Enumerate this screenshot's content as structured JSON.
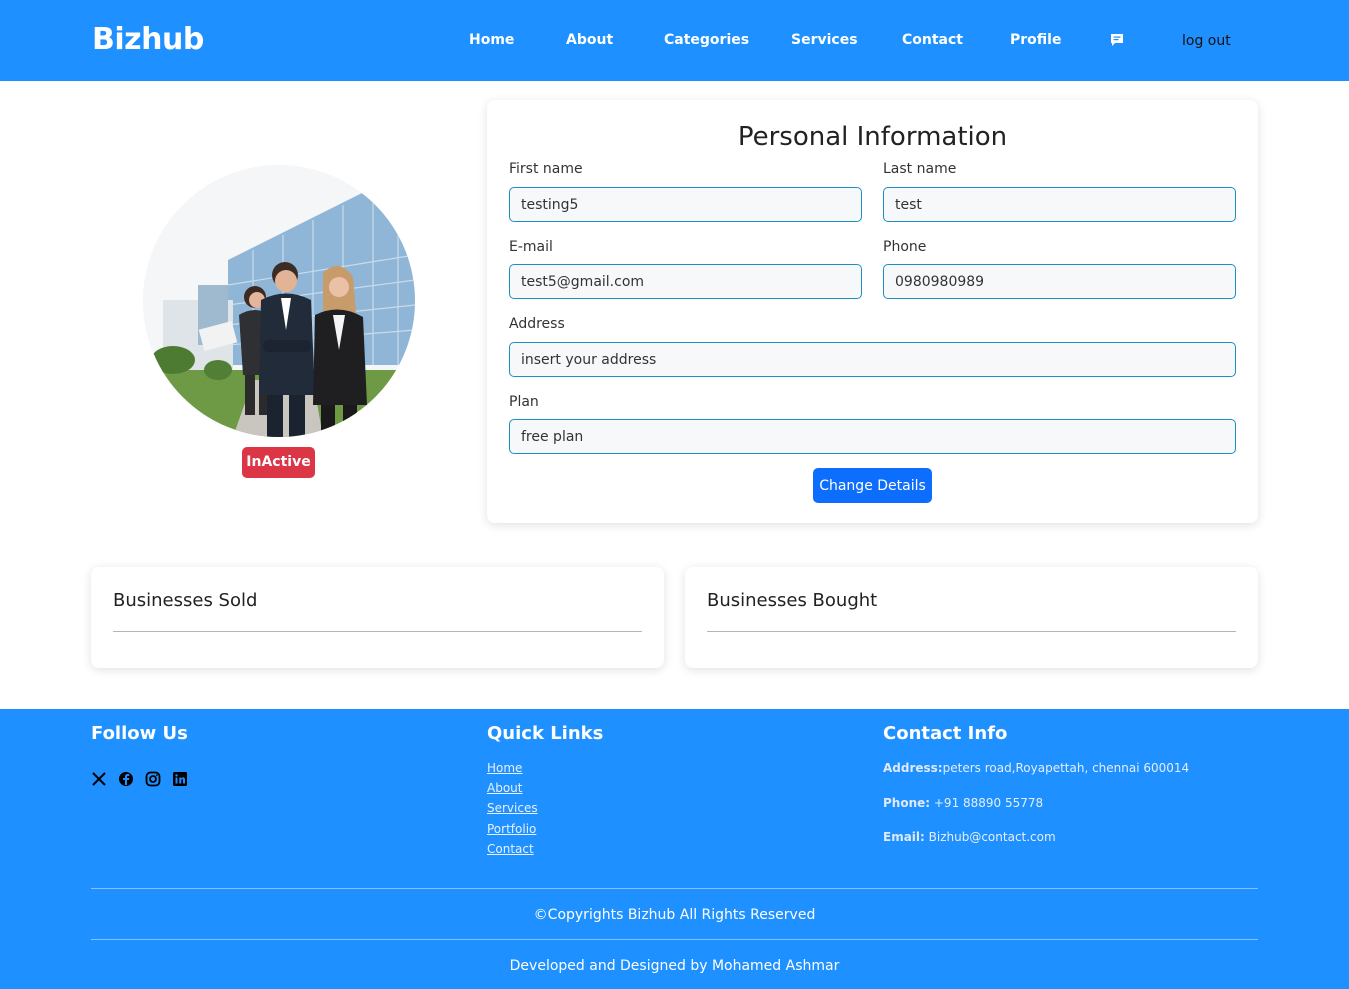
{
  "header": {
    "brand": "Bizhub",
    "nav": [
      "Home",
      "About",
      "Categories",
      "Services",
      "Contact",
      "Profile"
    ],
    "chat_icon": "chat-icon",
    "logout": "log out"
  },
  "profile": {
    "status": "InActive",
    "status_color": "#dc3545"
  },
  "form": {
    "title": "Personal Information",
    "first_name_label": "First name",
    "first_name": "testing5",
    "last_name_label": "Last name",
    "last_name": "test",
    "email_label": "E-mail",
    "email": "test5@gmail.com",
    "phone_label": "Phone",
    "phone": "0980980989",
    "address_label": "Address",
    "address": "insert your address",
    "plan_label": "Plan",
    "plan": "free plan",
    "submit": "Change Details"
  },
  "businesses": {
    "sold_title": "Businesses Sold",
    "bought_title": "Businesses Bought"
  },
  "footer": {
    "follow_title": "Follow Us",
    "social_icons": [
      "x-icon",
      "facebook-icon",
      "instagram-icon",
      "linkedin-icon"
    ],
    "links_title": "Quick Links",
    "links": [
      "Home",
      "About",
      "Services",
      "Portfolio",
      "Contact"
    ],
    "contact_title": "Contact Info",
    "address_key": "Address:",
    "address_val": "peters road,Royapettah, chennai 600014",
    "phone_key": "Phone:",
    "phone_val": " +91 88890 55778",
    "email_key": "Email:",
    "email_val": " Bizhub@contact.com",
    "copyright": "©Copyrights Bizhub All Rights Reserved",
    "credits": "Developed and Designed by Mohamed Ashmar"
  },
  "colors": {
    "primary": "#1e90ff",
    "button": "#0d6efd",
    "danger": "#dc3545"
  }
}
